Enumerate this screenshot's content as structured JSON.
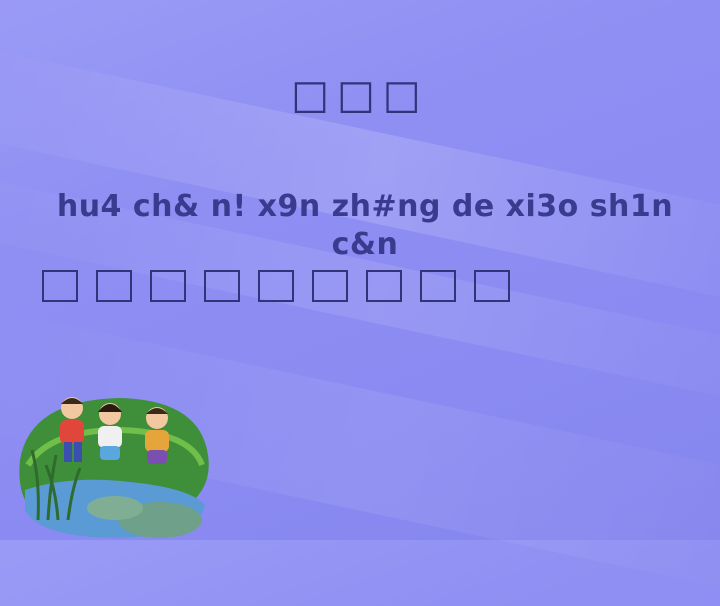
{
  "slide": {
    "title_glyphs": "□□□",
    "pinyin_line1": "hu4 ch& n! x9n zh#ng de xi3o sh1n",
    "pinyin_line2": "c&n",
    "hanzi_count": 9
  },
  "colors": {
    "background": "#8f8ff3",
    "text_dark": "#33337a",
    "text_pinyin": "#3a3a8e"
  },
  "icons": {
    "illustration": "children-sitting-by-pond-illustration"
  }
}
